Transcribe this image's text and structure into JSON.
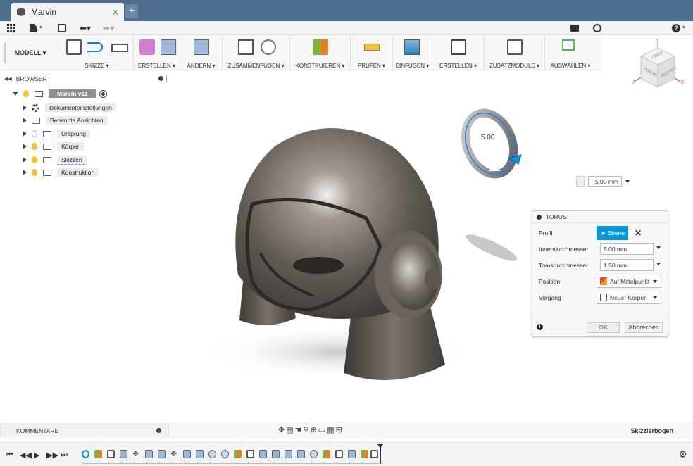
{
  "window": {
    "tab_title": "Marvin",
    "close_glyph": "×",
    "new_tab_glyph": "+"
  },
  "ribbon": {
    "model_label": "MODELL ▾",
    "groups": [
      {
        "label": "SKIZZE ▾"
      },
      {
        "label": "ERSTELLEN ▾"
      },
      {
        "label": "ÄNDERN ▾"
      },
      {
        "label": "ZUSAMMENFÜGEN ▾"
      },
      {
        "label": "KONSTRUIEREN ▾"
      },
      {
        "label": "PRÜFEN ▾"
      },
      {
        "label": "EINFÜGEN ▾"
      },
      {
        "label": "ERSTELLEN ▾"
      },
      {
        "label": "ZUSATZMODULE ▾"
      },
      {
        "label": "AUSWÄHLEN ▾"
      }
    ]
  },
  "viewcube": {
    "top": "OBEN",
    "front": "VORNE",
    "right": "RECHTS",
    "axis_x": "X",
    "axis_y": "Y",
    "axis_z": "Z"
  },
  "browser": {
    "title": "BROWSER",
    "root": "Marvin v11",
    "items": [
      {
        "label": "Dokumenteinstellungen"
      },
      {
        "label": "Benannte Ansichten"
      },
      {
        "label": "Ursprung"
      },
      {
        "label": "Körper"
      },
      {
        "label": "Skizzen"
      },
      {
        "label": "Konstruktion"
      }
    ]
  },
  "canvas": {
    "manipulator_value": "5.00",
    "value_box": "5.00 mm"
  },
  "torus_panel": {
    "title": "TORUS",
    "rows": [
      {
        "label": "Profil",
        "value": "Ebene"
      },
      {
        "label": "Innendurchmesser",
        "value": "5.00 mm"
      },
      {
        "label": "Torusdurchmesser",
        "value": "1.50 mm"
      },
      {
        "label": "Position",
        "value": "Auf Mittelpunkt"
      },
      {
        "label": "Vorgang",
        "value": "Neuer Körper"
      }
    ],
    "ok": "OK",
    "cancel": "Abbrechen"
  },
  "bottom": {
    "comments": "KOMMENTARE",
    "status": "Skizzierbogen"
  },
  "colors": {
    "titlebar": "#4f6d8c",
    "accent": "#0696d7",
    "bulb": "#f1c232"
  }
}
